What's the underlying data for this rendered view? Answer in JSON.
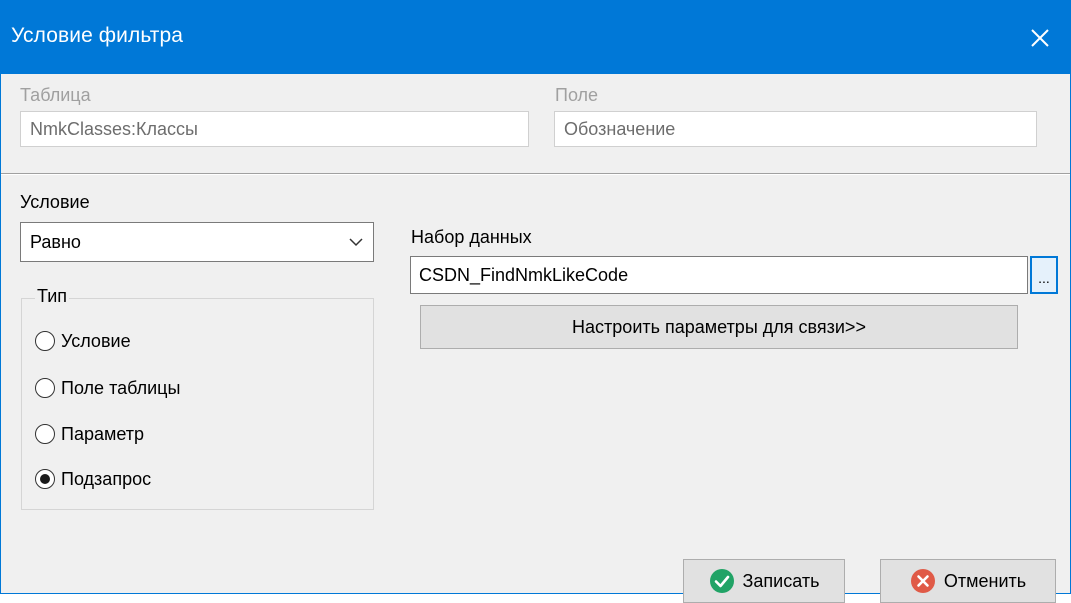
{
  "window": {
    "title": "Условие фильтра"
  },
  "table_field": {
    "label": "Таблица",
    "value": "NmkClasses:Классы"
  },
  "field_field": {
    "label": "Поле",
    "value": "Обозначение"
  },
  "condition": {
    "label": "Условие",
    "selected": "Равно"
  },
  "type_group": {
    "title": "Тип",
    "options": [
      {
        "label": "Условие",
        "checked": false
      },
      {
        "label": "Поле таблицы",
        "checked": false
      },
      {
        "label": "Параметр",
        "checked": false
      },
      {
        "label": "Подзапрос",
        "checked": true
      }
    ]
  },
  "dataset": {
    "label": "Набор данных",
    "value": "CSDN_FindNmkLikeCode",
    "browse_label": "..."
  },
  "configure_button": {
    "label": "Настроить параметры для связи>>"
  },
  "footer": {
    "save_label": "Записать",
    "cancel_label": "Отменить"
  },
  "colors": {
    "titlebar": "#0078d7",
    "save_icon": "#21a366",
    "cancel_icon": "#e05a47"
  },
  "icons": {
    "close": "close-icon",
    "combo": "chevron-down-icon",
    "save": "check-circle-icon",
    "cancel": "x-circle-icon"
  }
}
